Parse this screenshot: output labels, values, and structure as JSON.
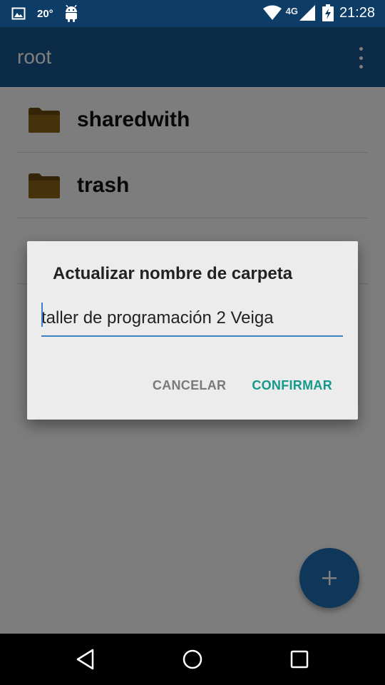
{
  "status_bar": {
    "temperature": "20°",
    "network": "4G",
    "time": "21:28"
  },
  "app_bar": {
    "title": "root"
  },
  "folders": [
    {
      "label": "sharedwith"
    },
    {
      "label": "trash"
    }
  ],
  "dialog": {
    "title": "Actualizar nombre de carpeta",
    "input_value": "taller de programación 2 Veiga",
    "cancel_label": "CANCELAR",
    "confirm_label": "CONFIRMAR"
  },
  "colors": {
    "status_bar": "#0d3c66",
    "app_bar": "#16578f",
    "fab": "#1e6fb5",
    "accent": "#14998a",
    "input_underline": "#3b82c4"
  },
  "icons": {
    "fab": "plus-icon",
    "folder": "folder-icon",
    "back": "back-icon",
    "home": "home-icon",
    "recents": "recents-icon"
  }
}
